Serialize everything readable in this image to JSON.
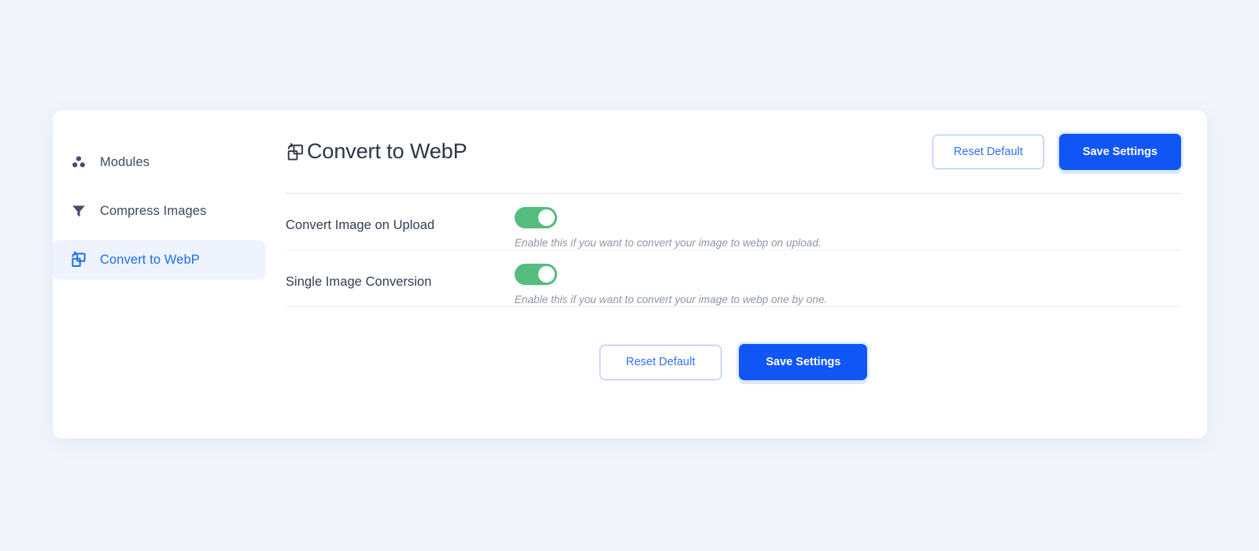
{
  "theme": {
    "page_background": "#f2f5fc",
    "card_background": "#ffffff",
    "primary_blue": "#1055f5",
    "link_blue": "#2f73f0",
    "active_nav_background": "#eef3fe",
    "toggle_on_green": "#55bd7d",
    "text_dark": "#2b3648",
    "text_muted": "#8d96a5"
  },
  "sidebar": {
    "items": [
      {
        "id": "modules",
        "label": "Modules",
        "icon": "three-dots-modules-icon",
        "active": false
      },
      {
        "id": "compress-images",
        "label": "Compress Images",
        "icon": "funnel-filter-icon",
        "active": false
      },
      {
        "id": "convert-to-webp",
        "label": "Convert to WebP",
        "icon": "convert-layers-icon",
        "active": true
      }
    ]
  },
  "header": {
    "title": "Convert to WebP",
    "title_icon": "convert-layers-icon",
    "reset_label": "Reset Default",
    "save_label": "Save Settings"
  },
  "settings": {
    "rows": [
      {
        "id": "convert-image-on-upload",
        "label": "Convert Image on Upload",
        "toggle_state": "on",
        "help": "Enable this if you want to convert your image to webp on upload."
      },
      {
        "id": "single-image-conversion",
        "label": "Single Image Conversion",
        "toggle_state": "on",
        "help": "Enable this if you want to convert your image to webp one by one."
      }
    ]
  },
  "footer": {
    "reset_label": "Reset Default",
    "save_label": "Save Settings"
  }
}
